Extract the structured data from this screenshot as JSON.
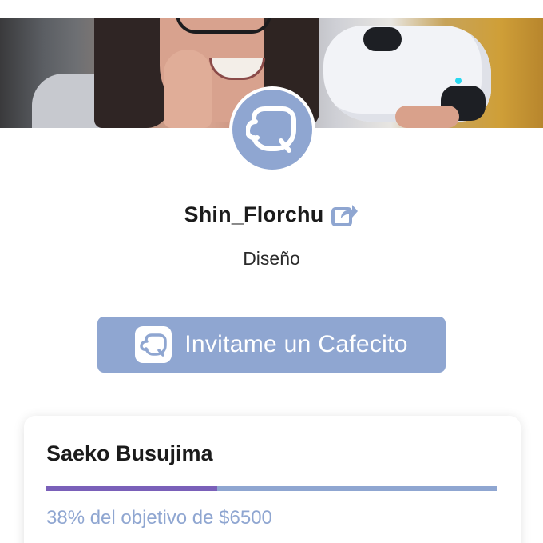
{
  "profile": {
    "username": "Shin_Florchu",
    "category": "Diseño",
    "share_icon": "share-icon",
    "avatar_icon": "cafecito-logo-icon"
  },
  "cta": {
    "label": "Invitame un Cafecito",
    "icon": "cafecito-logo-icon"
  },
  "goal": {
    "title": "Saeko Busujima",
    "progress_percent": 38,
    "text": "38% del objetivo de $6500"
  },
  "colors": {
    "accent": "#8fa6d1",
    "progress_fill": "#7a60b9",
    "text_dark": "#1b1b1b"
  }
}
